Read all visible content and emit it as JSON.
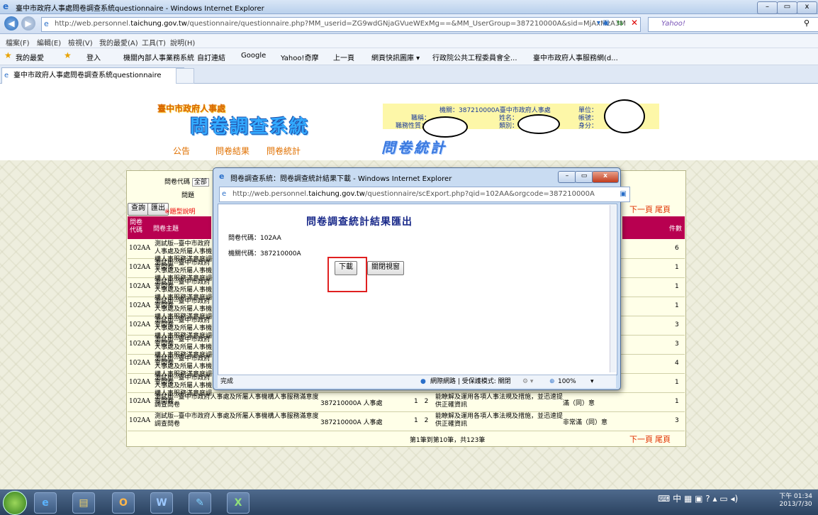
{
  "window": {
    "title": "臺中市政府人事處問卷調查系統questionnaire - Windows Internet Explorer",
    "address_prefix": "http://web.personnel.",
    "address_domain": "taichung.gov.tw",
    "address_rest": "/questionnaire/questionnaire.php?MM_userid=ZG9wdGNjaGVueWExMg==&MM_UserGroup=387210000A&sid=MjAxMzA3M",
    "search_placeholder": "Yahoo!"
  },
  "menu": {
    "items": [
      "檔案(F)",
      "編輯(E)",
      "檢視(V)",
      "我的最愛(A)",
      "工具(T)",
      "說明(H)"
    ]
  },
  "favorites": {
    "label": "我的最愛",
    "items": [
      "登入",
      "機關內部人事業務系統",
      "自訂連結",
      "Google",
      "Yahoo!奇摩",
      "上一頁",
      "網頁快訊圖庫 ▾",
      "行政院公共工程委員會全...",
      "臺中市政府人事服務網(d..."
    ]
  },
  "tab": {
    "label": "臺中市政府人事處問卷調查系統questionnaire"
  },
  "site": {
    "logo_small": "臺中市政府人事處",
    "logo_big": "問卷調查系統",
    "info_agency": "機關：387210000A臺中市政府人事處",
    "info_title": "職稱：",
    "info_type": "職務性質：",
    "info_name": "姓名：",
    "info_category": "類別：",
    "info_unit": "單位：",
    "info_account": "帳號：",
    "info_identity": "身分：",
    "nav": [
      "公告",
      "問卷結果",
      "問卷統計"
    ],
    "page_title": "問卷統計"
  },
  "bg": {
    "code_label": "問卷代碼",
    "code_value": "全部",
    "question_label": "問題",
    "query_btn": "查詢",
    "export_btn": "匯出",
    "legend": "※題型說明",
    "head_code": "問卷代碼",
    "head_subject": "問卷主題",
    "head_count": "件數",
    "next_page": "下一頁",
    "last_page": "尾頁",
    "page_info": "第1筆到第10筆，共123筆",
    "rows": [
      {
        "code": "102AA",
        "subject": "測試版--臺中市政府人事處及所屬人事機構人事服務滿意度調查問卷",
        "org": "",
        "num": "",
        "option": "",
        "answer": "",
        "count": "6"
      },
      {
        "code": "102AA",
        "subject": "測試版--臺中市政府人事處及所屬人事機構人事服務滿意度調查問卷",
        "org": "",
        "num": "",
        "option": "",
        "answer": "",
        "count": "1"
      },
      {
        "code": "102AA",
        "subject": "測試版--臺中市政府人事處及所屬人事機構人事服務滿意度調查問卷",
        "org": "",
        "num": "",
        "option": "",
        "answer": "",
        "count": "1"
      },
      {
        "code": "102AA",
        "subject": "測試版--臺中市政府人事處及所屬人事機構人事服務滿意度調查問卷",
        "org": "",
        "num": "",
        "option": "",
        "answer": "",
        "count": "1"
      },
      {
        "code": "102AA",
        "subject": "測試版--臺中市政府人事處及所屬人事機構人事服務滿意度調查問卷",
        "org": "",
        "num": "",
        "option": "",
        "answer": "",
        "count": "3"
      },
      {
        "code": "102AA",
        "subject": "測試版--臺中市政府人事處及所屬人事機構人事服務滿意度調查問卷",
        "org": "",
        "num": "",
        "option": "",
        "answer": "",
        "count": "3"
      },
      {
        "code": "102AA",
        "subject": "測試版--臺中市政府人事處及所屬人事機構人事服務滿意度調查問卷",
        "org": "",
        "num": "",
        "option": "",
        "answer": "",
        "count": "4"
      },
      {
        "code": "102AA",
        "subject": "測試版--臺中市政府人事處及所屬人事機構人事服務滿意度調查問卷",
        "org": "",
        "num": "",
        "option": "",
        "answer": "",
        "count": "1"
      },
      {
        "code": "102AA",
        "subject": "測試版--臺中市政府人事處及所屬人事機構人事服務滿意度調查問卷",
        "org": "387210000A 人事處",
        "num": "1 2",
        "option": "能瞭解及運用各項人事法規及措施，並迅速提供正確資訊",
        "answer": "滿（同）意",
        "count": "1"
      },
      {
        "code": "102AA",
        "subject": "測試版--臺中市政府人事處及所屬人事機構人事服務滿意度調查問卷",
        "org": "387210000A 人事處",
        "num": "1 2",
        "option": "能瞭解及運用各項人事法規及措施，並迅速提供正確資訊",
        "answer": "非常滿（同）意",
        "count": "3"
      }
    ]
  },
  "dialog": {
    "title": "問卷調查系統：問卷調查統計結果下載 - Windows Internet Explorer",
    "address_prefix": "http://web.personnel.",
    "address_domain": "taichung.gov.tw",
    "address_rest": "/questionnaire/scExport.php?qid=102AA&orgcode=387210000A",
    "heading": "問卷調查統計結果匯出",
    "code_line": "問卷代碼：102AA",
    "org_line": "機關代碼：387210000A",
    "download_btn": "下載",
    "close_btn": "關閉視窗",
    "status_done": "完成",
    "status_zone": "網際網路 | 受保護模式: 關閉",
    "zoom": "100%"
  },
  "taskbar": {
    "tray": "中",
    "clock_time": "下午 01:34",
    "clock_date": "2013/7/30"
  },
  "colors": {
    "accent": "#b80050",
    "highlight": "#e02020",
    "link": "#e07000"
  }
}
